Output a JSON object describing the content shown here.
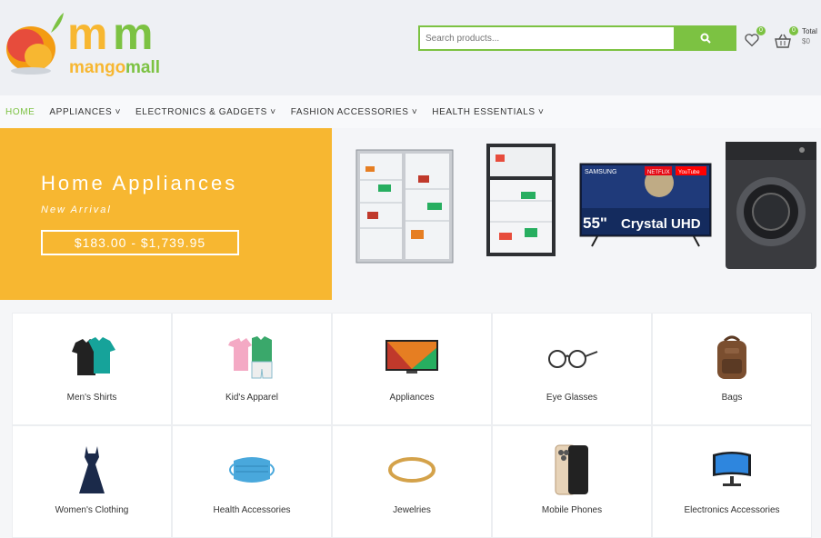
{
  "brand": {
    "name": "mangomall",
    "green": "#7cc242",
    "yellow": "#f7b731"
  },
  "search": {
    "placeholder": "Search products...",
    "button_icon": "search-icon"
  },
  "header": {
    "wishlist_count": "0",
    "cart_count": "0",
    "total_label": "Total",
    "total_value": "$0"
  },
  "nav": {
    "items": [
      "HOME",
      "APPLIANCES ˅",
      "ELECTRONICS & GADGETS ˅",
      "FASHION ACCESSORIES ˅",
      "HEALTH ESSENTIALS ˅"
    ]
  },
  "hero": {
    "title": "Home Appliances",
    "subtitle": "New Arrival",
    "price_range": "$183.00 - $1,739.95",
    "tv_brand": "SAMSUNG",
    "tv_size": "55\"",
    "tv_model": "Crystal UHD",
    "tv_apps": [
      "NETFLIX",
      "YouTube"
    ]
  },
  "categories": [
    {
      "label": "Men's Shirts",
      "icon": "shirts-icon"
    },
    {
      "label": "Kid's Apparel",
      "icon": "kids-apparel-icon"
    },
    {
      "label": "Appliances",
      "icon": "tv-icon"
    },
    {
      "label": "Eye Glasses",
      "icon": "glasses-icon"
    },
    {
      "label": "Bags",
      "icon": "backpack-icon"
    },
    {
      "label": "Women's Clothing",
      "icon": "dress-icon"
    },
    {
      "label": "Health Accessories",
      "icon": "face-mask-icon"
    },
    {
      "label": "Jewelries",
      "icon": "bracelet-icon"
    },
    {
      "label": "Mobile Phones",
      "icon": "smartphone-icon"
    },
    {
      "label": "Electronics Accessories",
      "icon": "monitor-icon"
    }
  ]
}
